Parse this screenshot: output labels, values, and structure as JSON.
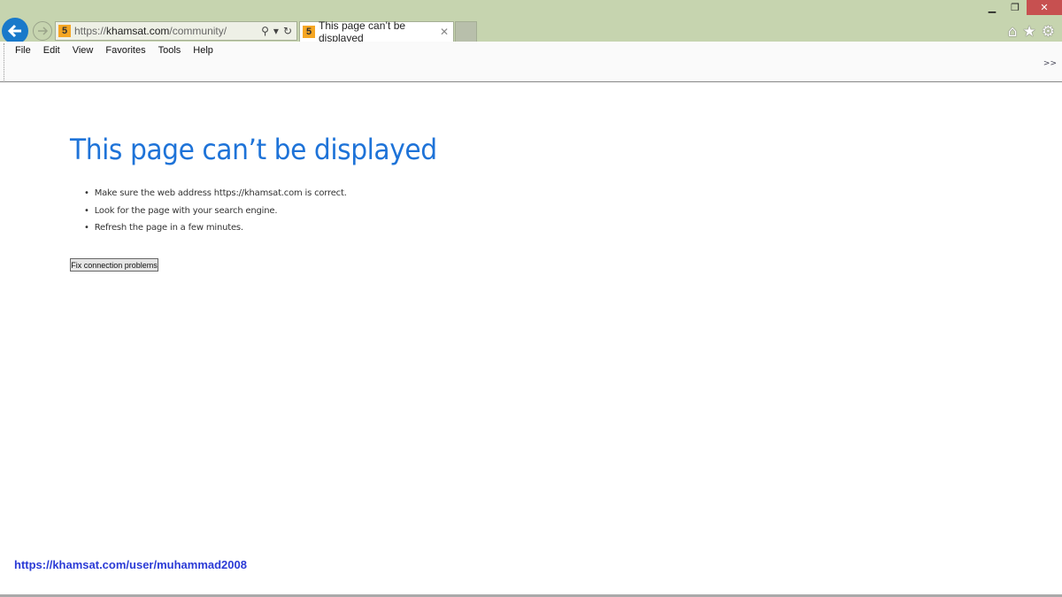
{
  "browser": {
    "address": {
      "scheme": "https://",
      "domain": "khamsat.com",
      "path": "/community/"
    },
    "tab": {
      "title": "This page can’t be displayed"
    },
    "menu": [
      "File",
      "Edit",
      "View",
      "Favorites",
      "Tools",
      "Help"
    ],
    "toolbar_icons": [
      "home-icon",
      "star-icon",
      "gear-icon"
    ],
    "accent": "#1979ca",
    "frame_color": "#c6d4af"
  },
  "page": {
    "title": "This page can’t be displayed",
    "tips": [
      "Make sure the web address https://khamsat.com is correct.",
      "Look for the page with your search engine.",
      "Refresh the page in a few minutes."
    ],
    "fix_button": "Fix connection problems"
  },
  "overlay_link": "https://khamsat.com/user/muhammad2008"
}
